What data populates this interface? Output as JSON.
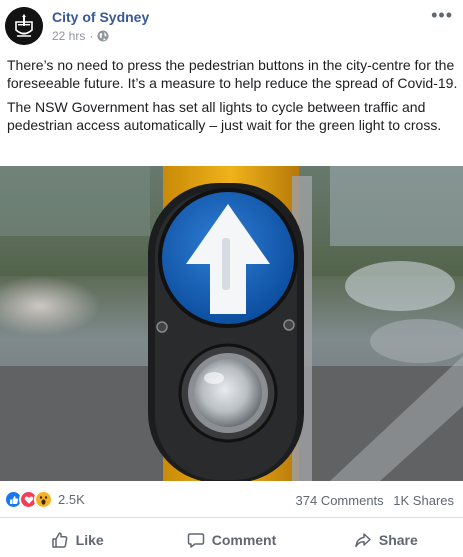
{
  "post": {
    "page_name": "City of Sydney",
    "timestamp": "22 hrs",
    "separator": "·",
    "privacy_icon": "globe-icon",
    "more_icon": "more-options-icon",
    "paragraphs": [
      "There’s no need to press the pedestrian buttons in the city-centre for the foreseeable future. It’s a measure to help reduce the spread of Covid-19.",
      "The NSW Government has set all lights to cycle between traffic and pedestrian access automatically – just wait for the green light to cross."
    ],
    "photo_icon": "pedestrian-button-photo"
  },
  "stats": {
    "reaction_icons": [
      "like-reaction-icon",
      "love-reaction-icon",
      "wow-reaction-icon"
    ],
    "reaction_count": "2.5K",
    "comments": "374 Comments",
    "shares": "1K Shares"
  },
  "actions": {
    "like": "Like",
    "comment": "Comment",
    "share": "Share"
  },
  "colors": {
    "page_name": "#385898",
    "like_blue": "#1877f2",
    "love_red": "#f33e58",
    "wow_yellow": "#f7b125",
    "muted": "#606770"
  }
}
